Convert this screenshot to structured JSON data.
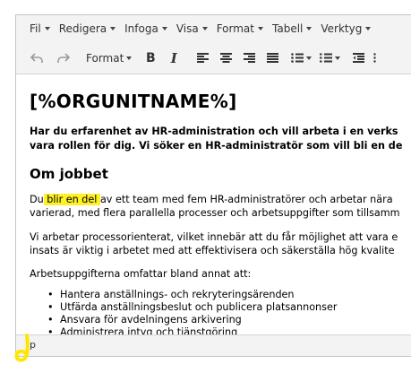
{
  "menubar": {
    "items": [
      {
        "label": "Fil"
      },
      {
        "label": "Redigera"
      },
      {
        "label": "Infoga"
      },
      {
        "label": "Visa"
      },
      {
        "label": "Format"
      },
      {
        "label": "Tabell"
      },
      {
        "label": "Verktyg"
      }
    ]
  },
  "toolbar": {
    "format_label": "Format",
    "bold_label": "B",
    "italic_label": "I",
    "icons": [
      "undo-icon",
      "redo-icon",
      "align-left-icon",
      "align-center-icon",
      "align-right-icon",
      "align-justify-icon",
      "bullet-list-icon",
      "numbered-list-icon",
      "outdent-icon"
    ]
  },
  "content": {
    "title": "[%ORGUNITNAME%]",
    "lead_line1": "Har du erfarenhet av HR-administration och vill arbeta i en verks",
    "lead_line2": "vara rollen för dig. Vi söker en HR-administratör som vill bli en de",
    "section_heading": "Om jobbet",
    "p1_start": "Du",
    "p1_highlight": " blir en del ",
    "p1_rest": "av ett team med fem HR-administratörer och arbetar nära",
    "p1_line2": "varierad, med flera parallella processer och arbetsuppgifter som tillsamm",
    "p2_line1": "Vi arbetar processorienterat, vilket innebär att du får möjlighet att vara e",
    "p2_line2": "insats är viktig i arbetet med att effektivisera och säkerställa hög kvalite",
    "p3": "Arbetsuppgifterna omfattar bland annat att:",
    "bullets": [
      "Hantera anställnings- och rekryteringsärenden",
      "Utfärda anställningsbeslut och publicera platsannonser",
      "Ansvara för avdelningens arkivering",
      "Administrera intyg och tjänstgöring"
    ]
  },
  "statusbar": {
    "path": "p"
  },
  "colors": {
    "highlight": "#ffee00",
    "annotation": "#ffe600",
    "chrome_bg": "#f3f3f3"
  }
}
